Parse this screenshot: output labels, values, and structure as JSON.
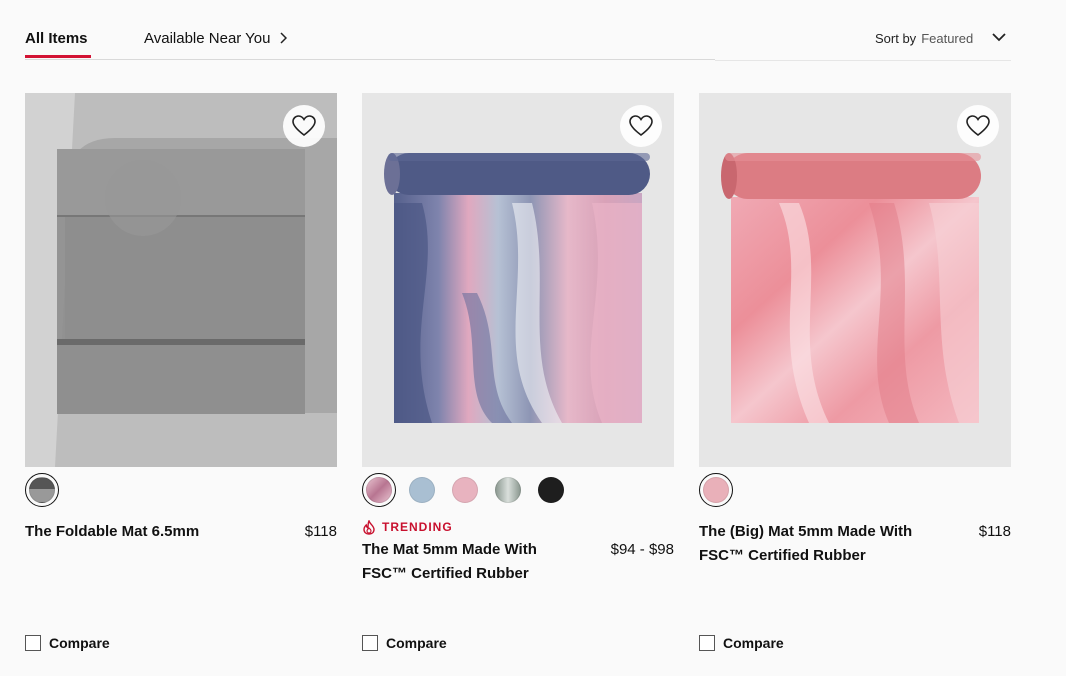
{
  "tabs": {
    "all_items": "All Items",
    "available_near_you": "Available Near You"
  },
  "sort": {
    "label": "Sort by",
    "value": "Featured"
  },
  "colors": {
    "accent": "#d31334",
    "trending": "#c8102e"
  },
  "products": [
    {
      "name": "The Foldable Mat 6.5mm",
      "price": "$118",
      "swatches": [
        "#3b3b3b"
      ],
      "compare": "Compare"
    },
    {
      "badge": "TRENDING",
      "name": "The Mat 5mm Made With FSC™ Certified Rubber",
      "price": "$94 - $98",
      "swatches": [
        "#d8a9b9",
        "#a9bfd2",
        "#e8b3bf",
        "#a9b5ae",
        "#1e1e1e"
      ],
      "compare": "Compare"
    },
    {
      "name": "The (Big) Mat 5mm Made With FSC™ Certified Rubber",
      "price": "$118",
      "swatches": [
        "#e9b0b9"
      ],
      "compare": "Compare"
    }
  ]
}
